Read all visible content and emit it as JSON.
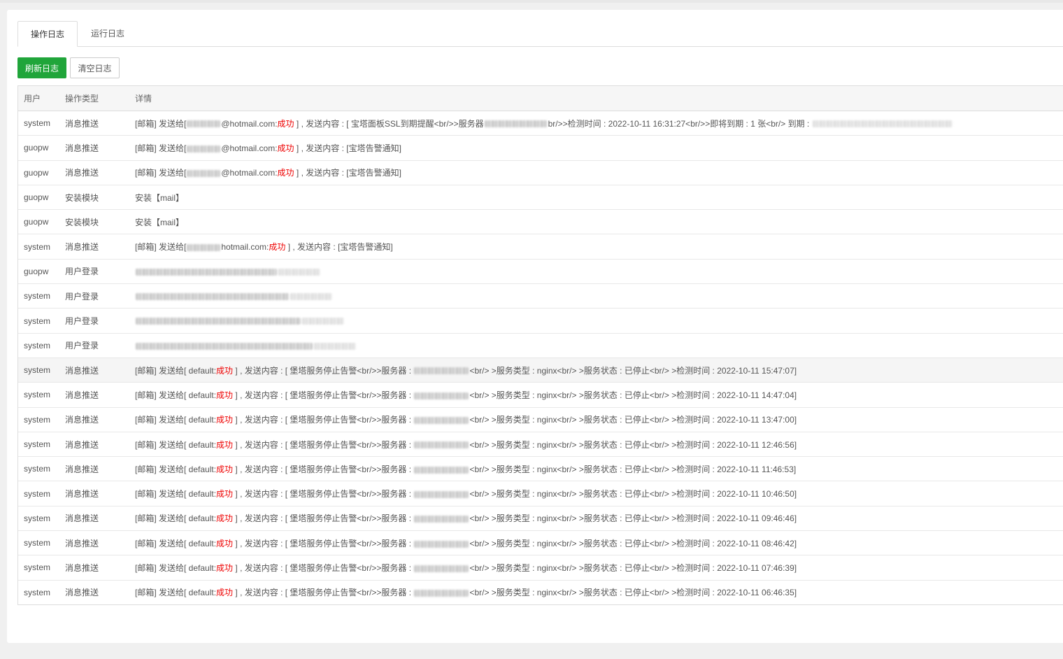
{
  "tabs": [
    {
      "label": "操作日志",
      "active": true
    },
    {
      "label": "运行日志",
      "active": false
    }
  ],
  "toolbar": {
    "refresh_label": "刷新日志",
    "clear_label": "清空日志"
  },
  "table": {
    "headers": [
      "用户",
      "操作类型",
      "详情"
    ],
    "rows": [
      {
        "user": "system",
        "type": "消息推送",
        "kind": "ssl",
        "p1": "[邮箱] 发送给[",
        "p2": "@hotmail.com:",
        "ok": "成功",
        "p3": " ] , 发送内容 : [ 宝塔面板SSL到期提醒<br/>>服务器",
        "p4": "br/>>检测时间 : 2022-10-11 16:31:27<br/>>即将到期 : 1 张<br/> 到期 : "
      },
      {
        "user": "guopw",
        "type": "消息推送",
        "kind": "mail",
        "p1": "[邮箱] 发送给[",
        "p2": "@hotmail.com:",
        "ok": "成功",
        "p3": " ] , 发送内容 : [宝塔告警通知]"
      },
      {
        "user": "guopw",
        "type": "消息推送",
        "kind": "mail",
        "p1": "[邮箱] 发送给[",
        "p2": "@hotmail.com:",
        "ok": "成功",
        "p3": " ] , 发送内容 : [宝塔告警通知]"
      },
      {
        "user": "guopw",
        "type": "安装模块",
        "kind": "plain",
        "p1": "安装【mail】"
      },
      {
        "user": "guopw",
        "type": "安装模块",
        "kind": "plain",
        "p1": "安装【mail】"
      },
      {
        "user": "system",
        "type": "消息推送",
        "kind": "mail",
        "p1": "[邮箱] 发送给[",
        "p2": "hotmail.com:",
        "ok": "成功",
        "p3": " ] , 发送内容 : [宝塔告警通知]"
      },
      {
        "user": "guopw",
        "type": "用户登录",
        "kind": "hidden"
      },
      {
        "user": "system",
        "type": "用户登录",
        "kind": "hidden"
      },
      {
        "user": "system",
        "type": "用户登录",
        "kind": "hidden"
      },
      {
        "user": "system",
        "type": "用户登录",
        "kind": "hidden"
      },
      {
        "user": "system",
        "type": "消息推送",
        "kind": "svc",
        "highlight": true,
        "p1": "[邮箱] 发送给[ default:",
        "ok": "成功",
        "p3": " ] , 发送内容 : [ 堡塔服务停止告警<br/>>服务器 : ",
        "p4": "<br/> >服务类型 : nginx<br/> >服务状态 : 已停止<br/> >检测时间 : 2022-10-11 15:47:07]"
      },
      {
        "user": "system",
        "type": "消息推送",
        "kind": "svc",
        "p1": "[邮箱] 发送给[ default:",
        "ok": "成功",
        "p3": " ] , 发送内容 : [ 堡塔服务停止告警<br/>>服务器 : ",
        "p4": "<br/> >服务类型 : nginx<br/> >服务状态 : 已停止<br/> >检测时间 : 2022-10-11 14:47:04]"
      },
      {
        "user": "system",
        "type": "消息推送",
        "kind": "svc",
        "p1": "[邮箱] 发送给[ default:",
        "ok": "成功",
        "p3": " ] , 发送内容 : [ 堡塔服务停止告警<br/>>服务器 : ",
        "p4": "<br/> >服务类型 : nginx<br/> >服务状态 : 已停止<br/> >检测时间 : 2022-10-11 13:47:00]"
      },
      {
        "user": "system",
        "type": "消息推送",
        "kind": "svc",
        "p1": "[邮箱] 发送给[ default:",
        "ok": "成功",
        "p3": " ] , 发送内容 : [ 堡塔服务停止告警<br/>>服务器 : ",
        "p4": "<br/> >服务类型 : nginx<br/> >服务状态 : 已停止<br/> >检测时间 : 2022-10-11 12:46:56]"
      },
      {
        "user": "system",
        "type": "消息推送",
        "kind": "svc",
        "p1": "[邮箱] 发送给[ default:",
        "ok": "成功",
        "p3": " ] , 发送内容 : [ 堡塔服务停止告警<br/>>服务器 : ",
        "p4": "<br/> >服务类型 : nginx<br/> >服务状态 : 已停止<br/> >检测时间 : 2022-10-11 11:46:53]"
      },
      {
        "user": "system",
        "type": "消息推送",
        "kind": "svc",
        "p1": "[邮箱] 发送给[ default:",
        "ok": "成功",
        "p3": " ] , 发送内容 : [ 堡塔服务停止告警<br/>>服务器 : ",
        "p4": "<br/> >服务类型 : nginx<br/> >服务状态 : 已停止<br/> >检测时间 : 2022-10-11 10:46:50]"
      },
      {
        "user": "system",
        "type": "消息推送",
        "kind": "svc",
        "p1": "[邮箱] 发送给[ default:",
        "ok": "成功",
        "p3": " ] , 发送内容 : [ 堡塔服务停止告警<br/>>服务器 : ",
        "p4": "<br/> >服务类型 : nginx<br/> >服务状态 : 已停止<br/> >检测时间 : 2022-10-11 09:46:46]"
      },
      {
        "user": "system",
        "type": "消息推送",
        "kind": "svc",
        "p1": "[邮箱] 发送给[ default:",
        "ok": "成功",
        "p3": " ] , 发送内容 : [ 堡塔服务停止告警<br/>>服务器 : ",
        "p4": "<br/> >服务类型 : nginx<br/> >服务状态 : 已停止<br/> >检测时间 : 2022-10-11 08:46:42]"
      },
      {
        "user": "system",
        "type": "消息推送",
        "kind": "svc",
        "p1": "[邮箱] 发送给[ default:",
        "ok": "成功",
        "p3": " ] , 发送内容 : [ 堡塔服务停止告警<br/>>服务器 : ",
        "p4": "<br/> >服务类型 : nginx<br/> >服务状态 : 已停止<br/> >检测时间 : 2022-10-11 07:46:39]"
      },
      {
        "user": "system",
        "type": "消息推送",
        "kind": "svc",
        "p1": "[邮箱] 发送给[ default:",
        "ok": "成功",
        "p3": " ] , 发送内容 : [ 堡塔服务停止告警<br/>>服务器 : ",
        "p4": "<br/> >服务类型 : nginx<br/> >服务状态 : 已停止<br/> >检测时间 : 2022-10-11 06:46:35]"
      }
    ]
  }
}
